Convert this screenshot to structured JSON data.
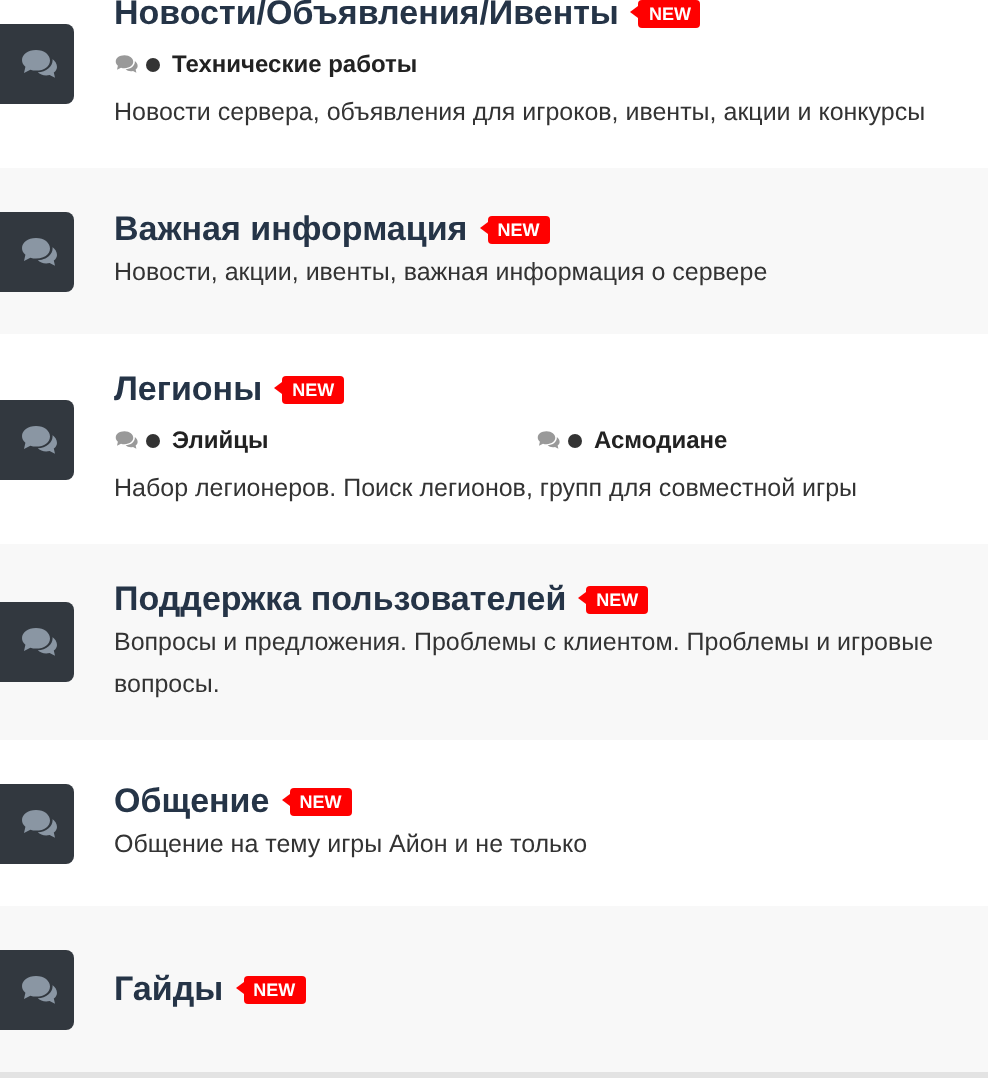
{
  "forums": [
    {
      "title": "Новости/Объявления/Ивенты",
      "badge": "NEW",
      "subforums": [
        "Технические работы"
      ],
      "description": "Новости сервера, объявления для игроков, ивенты, акции и конкурсы"
    },
    {
      "title": "Важная информация",
      "badge": "NEW",
      "description": "Новости, акции, ивенты, важная информация о сервере"
    },
    {
      "title": "Легионы",
      "badge": "NEW",
      "subforums": [
        "Элийцы",
        "Асмодиане"
      ],
      "description": "Набор легионеров. Поиск легионов, групп для совместной игры"
    },
    {
      "title": "Поддержка пользователей",
      "badge": "NEW",
      "description": "Вопросы и предложения. Проблемы с клиентом. Проблемы и игровые вопросы."
    },
    {
      "title": "Общение",
      "badge": "NEW",
      "description": "Общение на тему игры Айон и не только"
    },
    {
      "title": "Гайды",
      "badge": "NEW"
    }
  ]
}
